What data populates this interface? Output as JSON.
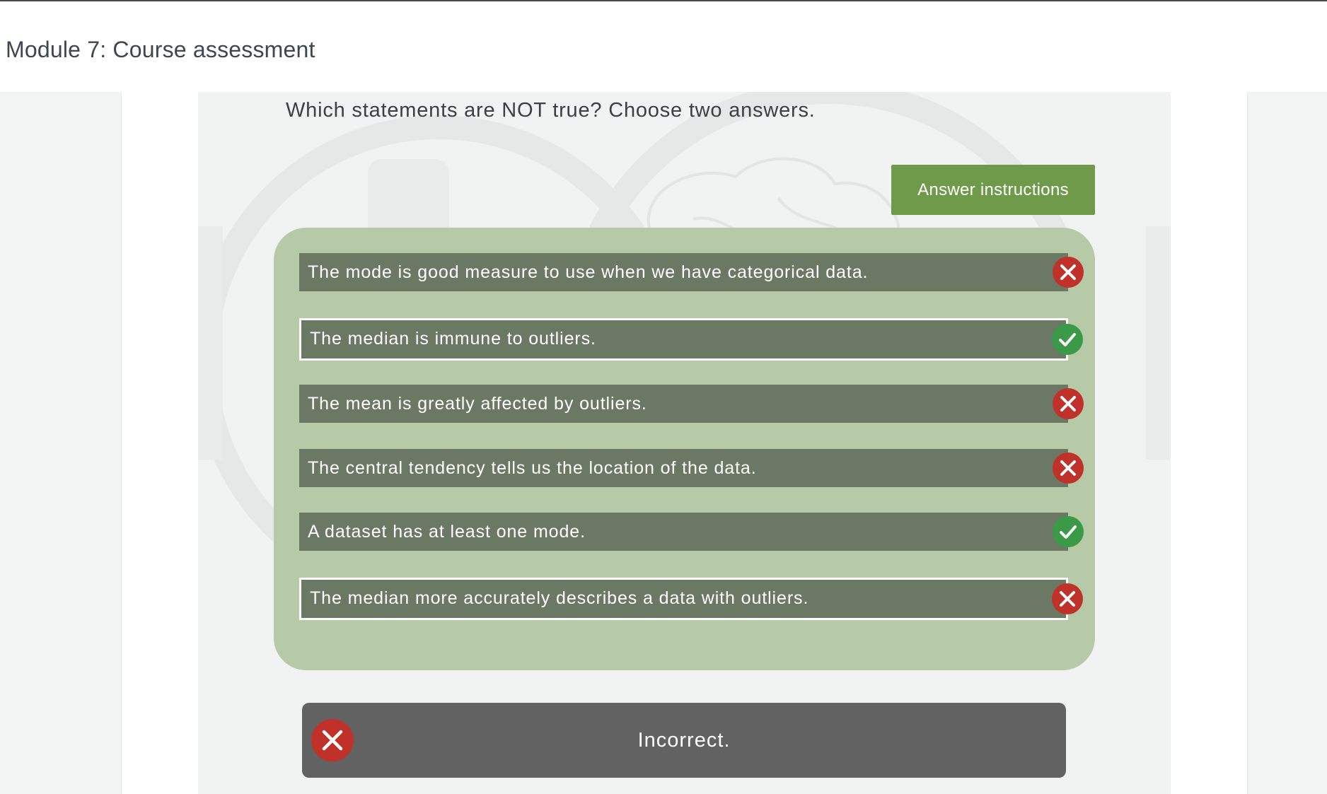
{
  "header": {
    "title": "Module 7: Course assessment"
  },
  "question": {
    "text": "Which statements are NOT true? Choose two answers."
  },
  "instructions_button": {
    "label": "Answer instructions"
  },
  "options": [
    {
      "text": "The mode is good measure to use when we have categorical data.",
      "selected": false,
      "result": "incorrect",
      "icon": "x-icon"
    },
    {
      "text": "The median is immune to outliers.",
      "selected": true,
      "result": "correct",
      "icon": "check-icon"
    },
    {
      "text": "The mean is greatly affected by outliers.",
      "selected": false,
      "result": "incorrect",
      "icon": "x-icon"
    },
    {
      "text": "The central tendency tells us the location of the data.",
      "selected": false,
      "result": "incorrect",
      "icon": "x-icon"
    },
    {
      "text": "A dataset has at least one mode.",
      "selected": false,
      "result": "correct",
      "icon": "check-icon"
    },
    {
      "text": "The median more accurately describes a data with outliers.",
      "selected": true,
      "result": "incorrect",
      "icon": "x-icon"
    }
  ],
  "feedback": {
    "text": "Incorrect.",
    "icon": "x-icon"
  },
  "colors": {
    "instructions_button": "#6e9a4a",
    "options_panel": "#b7caa8",
    "option_bg": "#6b7863",
    "correct": "#3a9a48",
    "incorrect": "#c0312a",
    "feedback_bg": "#626262"
  }
}
